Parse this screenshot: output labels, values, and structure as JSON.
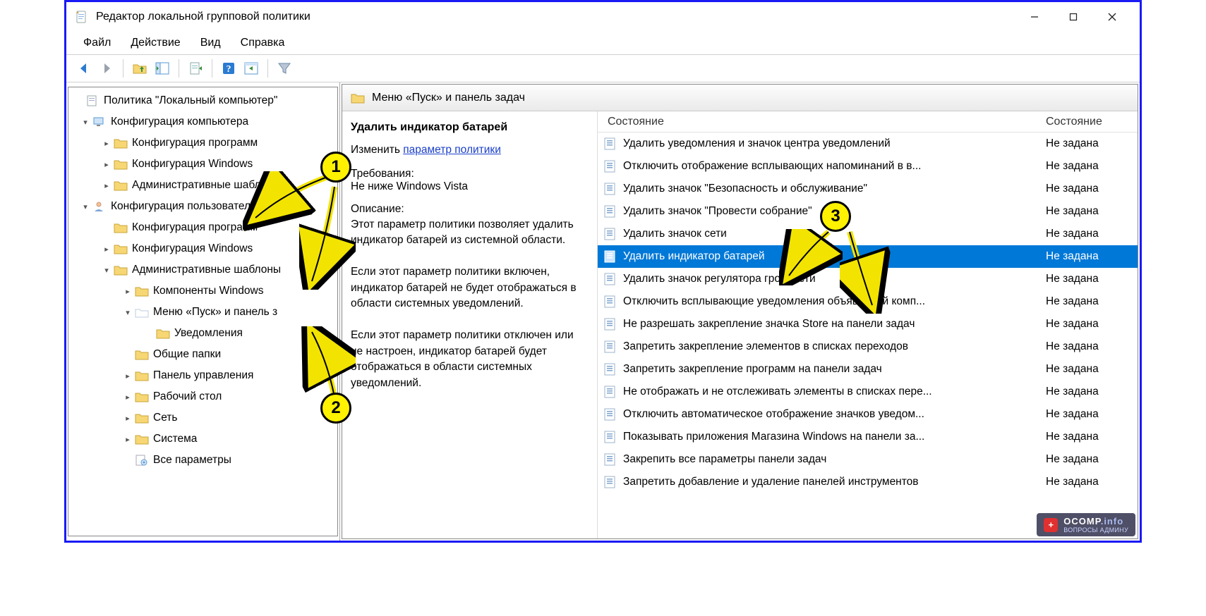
{
  "title": "Редактор локальной групповой политики",
  "menu": {
    "file": "Файл",
    "action": "Действие",
    "view": "Вид",
    "help": "Справка"
  },
  "tree": {
    "root": "Политика \"Локальный компьютер\"",
    "comp_conf": "Конфигурация компьютера",
    "comp_prog": "Конфигурация программ",
    "comp_win": "Конфигурация Windows",
    "comp_admin": "Административные шаблон",
    "user_conf": "Конфигурация пользователя",
    "user_prog": "Конфигурация программ",
    "user_win": "Конфигурация Windows",
    "user_admin": "Административные шаблоны",
    "comp_win_node": "Компоненты Windows",
    "startmenu": "Меню «Пуск» и панель з",
    "notif": "Уведомления",
    "shared": "Общие папки",
    "cpanel": "Панель управления",
    "desktop": "Рабочий стол",
    "network": "Сеть",
    "system": "Система",
    "allparams": "Все параметры"
  },
  "right": {
    "crumb": "Меню «Пуск» и панель задач",
    "policy_title": "Удалить индикатор батарей",
    "edit_prefix": "Изменить ",
    "edit_link": "параметр политики",
    "req_label": "Требования:",
    "req_text": "Не ниже Windows Vista",
    "desc_label": "Описание:",
    "desc_text1": "Этот параметр политики позволяет удалить индикатор батарей из системной области.",
    "desc_text2": "Если этот параметр политики включен, индикатор батарей не будет отображаться в области системных уведомлений.",
    "desc_text3": "Если этот параметр политики отключен или не настроен, индикатор батарей будет отображаться в области системных уведомлений."
  },
  "list": {
    "col_state_header": "Состояние",
    "col_state_header2": "Состояние",
    "state_default": "Не задана",
    "items": [
      "Удалить уведомления и значок центра уведомлений",
      "Отключить отображение всплывающих напоминаний в в...",
      "Удалить значок \"Безопасность и обслуживание\"",
      "Удалить значок \"Провести собрание\"",
      "Удалить значок сети",
      "Удалить индикатор батарей",
      "Удалить значок регулятора громкости",
      "Отключить всплывающие уведомления объявлений комп...",
      "Не разрешать закрепление значка Store на панели задач",
      "Запретить закрепление элементов в списках переходов",
      "Запретить закрепление программ на панели задач",
      "Не отображать и не отслеживать элементы в списках пере...",
      "Отключить автоматическое отображение значков уведом...",
      "Показывать приложения Магазина Windows на панели за...",
      "Закрепить все параметры панели задач",
      "Запретить добавление и удаление панелей инструментов"
    ],
    "selected_index": 5
  },
  "watermark": {
    "brand": "OCOMP",
    "tld": ".info",
    "sub": "ВОПРОСЫ АДМИНУ"
  },
  "annotations": {
    "b1": "1",
    "b2": "2",
    "b3": "3"
  }
}
